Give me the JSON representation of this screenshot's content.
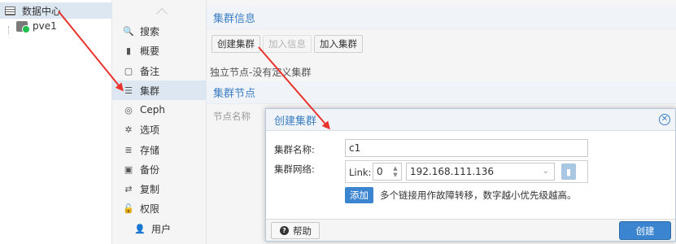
{
  "tree": {
    "datacenter_label": "数据中心",
    "node_label": "pve1"
  },
  "nav": {
    "items": [
      {
        "icon": "search-icon",
        "glyph": "🔍",
        "label": "搜索"
      },
      {
        "icon": "book-icon",
        "glyph": "▮",
        "label": "概要"
      },
      {
        "icon": "note-icon",
        "glyph": "▢",
        "label": "备注"
      },
      {
        "icon": "server-icon",
        "glyph": "☰",
        "label": "集群"
      },
      {
        "icon": "ceph-icon",
        "glyph": "◎",
        "label": "Ceph"
      },
      {
        "icon": "gear-icon",
        "glyph": "✲",
        "label": "选项"
      },
      {
        "icon": "database-icon",
        "glyph": "≣",
        "label": "存储"
      },
      {
        "icon": "floppy-icon",
        "glyph": "▣",
        "label": "备份"
      },
      {
        "icon": "retweet-icon",
        "glyph": "⇄",
        "label": "复制"
      },
      {
        "icon": "unlock-icon",
        "glyph": "🔓",
        "label": "权限"
      },
      {
        "icon": "user-icon",
        "glyph": "👤",
        "label": "用户"
      }
    ]
  },
  "main": {
    "cluster_info_title": "集群信息",
    "buttons": {
      "create_cluster": "创建集群",
      "join_info": "加入信息",
      "join_cluster": "加入集群"
    },
    "standalone_text": "独立节点-没有定义集群",
    "cluster_nodes_title": "集群节点",
    "node_name_header": "节点名称"
  },
  "dialog": {
    "title": "创建集群",
    "cluster_name_label": "集群名称:",
    "cluster_name_value": "c1",
    "cluster_network_label": "集群网络:",
    "link_label": "Link:",
    "link_value": "0",
    "ip_value": "192.168.111.136",
    "add_button": "添加",
    "add_hint": "多个链接用作故障转移，数字越小优先级越高。",
    "help_button": "帮助",
    "create_button": "创建"
  },
  "colors": {
    "accent": "#3b84cf",
    "title_blue": "#3b7ec4",
    "annotation_arrow": "#e8322b"
  }
}
